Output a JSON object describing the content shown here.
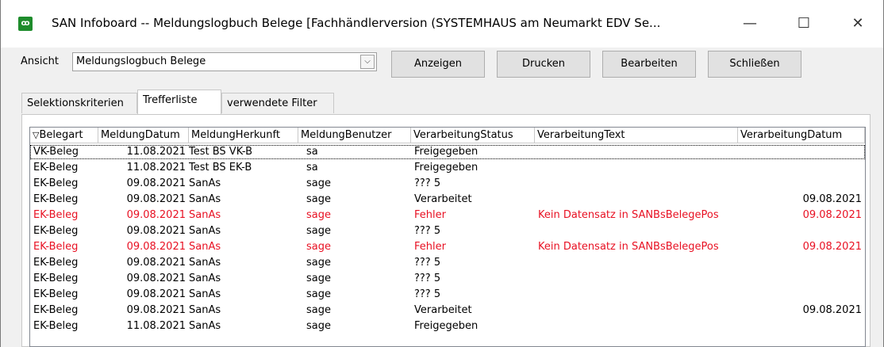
{
  "window": {
    "title": "SAN Infoboard -- Meldungslogbuch Belege [Fachhändlerversion (SYSTEMHAUS am Neumarkt EDV Se...",
    "minimize": "—",
    "maximize": "☐",
    "close": "✕"
  },
  "toolbar": {
    "view_label": "Ansicht",
    "view_value": "Meldungslogbuch Belege",
    "dropdown_glyph": "⌵",
    "btn_show": "Anzeigen",
    "btn_print": "Drucken",
    "btn_edit": "Bearbeiten",
    "btn_close": "Schließen"
  },
  "tabs": [
    {
      "label": "Selektionskriterien"
    },
    {
      "label": "Trefferliste"
    },
    {
      "label": "verwendete Filter"
    }
  ],
  "table": {
    "columns": [
      "Belegart",
      "MeldungDatum",
      "MeldungHerkunft",
      "MeldungBenutzer",
      "VerarbeitungStatus",
      "VerarbeitungText",
      "VerarbeitungDatum"
    ],
    "sort_glyph": "▽",
    "error_color": "#e81123",
    "rows": [
      {
        "c0": "VK-Beleg",
        "c1": "11.08.2021",
        "c2": "Test BS VK-B",
        "c3": "sa",
        "c4": "Freigegeben",
        "c5": "",
        "c6": "",
        "error": false
      },
      {
        "c0": "EK-Beleg",
        "c1": "11.08.2021",
        "c2": "Test BS EK-B",
        "c3": "sa",
        "c4": "Freigegeben",
        "c5": "",
        "c6": "",
        "error": false
      },
      {
        "c0": "EK-Beleg",
        "c1": "09.08.2021",
        "c2": "SanAs",
        "c3": "sage",
        "c4": "??? 5",
        "c5": "",
        "c6": "",
        "error": false
      },
      {
        "c0": "EK-Beleg",
        "c1": "09.08.2021",
        "c2": "SanAs",
        "c3": "sage",
        "c4": "Verarbeitet",
        "c5": "",
        "c6": "09.08.2021",
        "error": false
      },
      {
        "c0": "EK-Beleg",
        "c1": "09.08.2021",
        "c2": "SanAs",
        "c3": "sage",
        "c4": "Fehler",
        "c5": "Kein Datensatz in SANBsBelegePos",
        "c6": "09.08.2021",
        "error": true
      },
      {
        "c0": "EK-Beleg",
        "c1": "09.08.2021",
        "c2": "SanAs",
        "c3": "sage",
        "c4": "??? 5",
        "c5": "",
        "c6": "",
        "error": false
      },
      {
        "c0": "EK-Beleg",
        "c1": "09.08.2021",
        "c2": "SanAs",
        "c3": "sage",
        "c4": "Fehler",
        "c5": "Kein Datensatz in SANBsBelegePos",
        "c6": "09.08.2021",
        "error": true
      },
      {
        "c0": "EK-Beleg",
        "c1": "09.08.2021",
        "c2": "SanAs",
        "c3": "sage",
        "c4": "??? 5",
        "c5": "",
        "c6": "",
        "error": false
      },
      {
        "c0": "EK-Beleg",
        "c1": "09.08.2021",
        "c2": "SanAs",
        "c3": "sage",
        "c4": "??? 5",
        "c5": "",
        "c6": "",
        "error": false
      },
      {
        "c0": "EK-Beleg",
        "c1": "09.08.2021",
        "c2": "SanAs",
        "c3": "sage",
        "c4": "??? 5",
        "c5": "",
        "c6": "",
        "error": false
      },
      {
        "c0": "EK-Beleg",
        "c1": "09.08.2021",
        "c2": "SanAs",
        "c3": "sage",
        "c4": "Verarbeitet",
        "c5": "",
        "c6": "09.08.2021",
        "error": false
      },
      {
        "c0": "EK-Beleg",
        "c1": "11.08.2021",
        "c2": "SanAs",
        "c3": "sage",
        "c4": "Freigegeben",
        "c5": "",
        "c6": "",
        "error": false
      }
    ]
  }
}
